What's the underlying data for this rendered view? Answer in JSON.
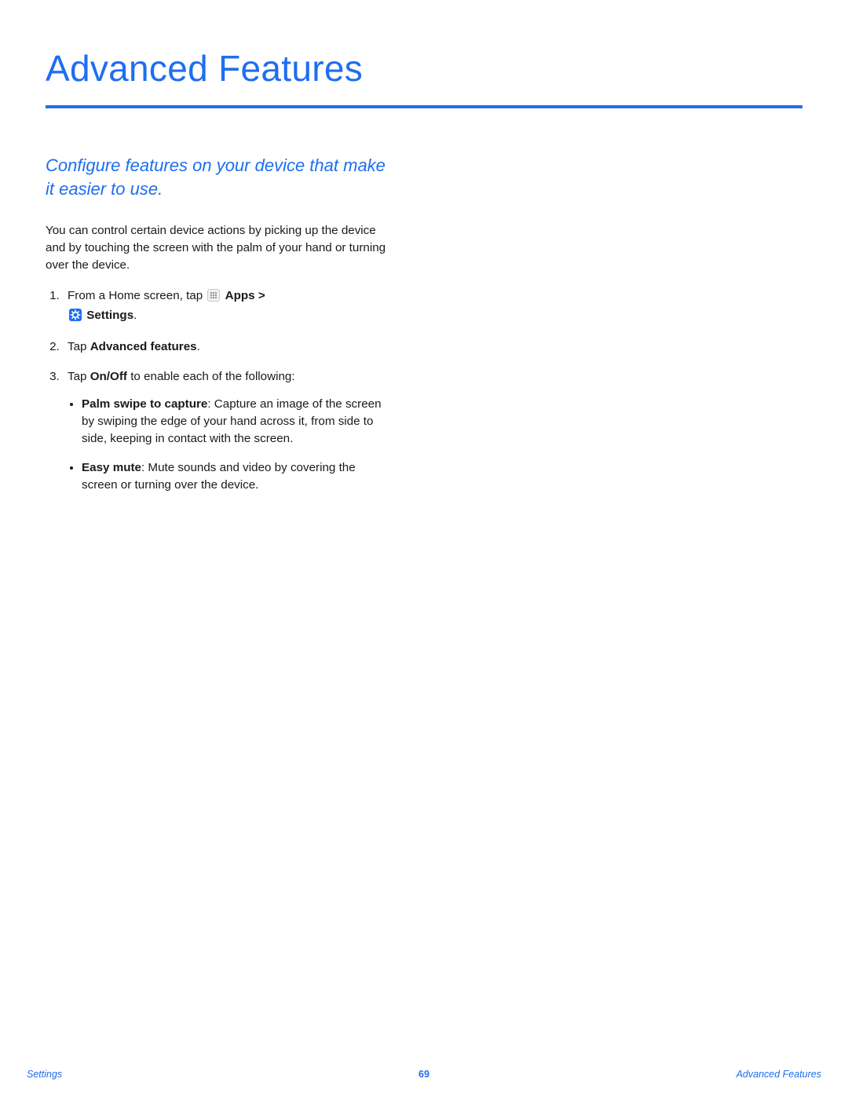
{
  "title": "Advanced Features",
  "subtitle": "Configure features on your device that make it easier to use.",
  "intro": "You can control certain device actions by picking up the device and by touching the screen with the palm of your hand or turning over the device.",
  "steps": {
    "s1_lead": "From a Home screen, tap ",
    "s1_apps": "Apps",
    "s1_gt": " > ",
    "s1_settings": "Settings",
    "s1_dot": ".",
    "s2_lead": "Tap ",
    "s2_bold": "Advanced features",
    "s2_dot": ".",
    "s3_lead": "Tap ",
    "s3_bold": "On/Off",
    "s3_tail": " to enable each of the following:"
  },
  "bullets": {
    "b1_title": "Palm swipe to capture",
    "b1_body": ": Capture an image of the screen by swiping the edge of your hand across it, from side to side, keeping in contact with the screen.",
    "b2_title": "Easy mute",
    "b2_body": ": Mute sounds and video by covering the screen or turning over the device."
  },
  "footer": {
    "left": "Settings",
    "center": "69",
    "right": "Advanced Features"
  },
  "icons": {
    "apps": "apps-grid-icon",
    "settings": "settings-gear-icon"
  }
}
